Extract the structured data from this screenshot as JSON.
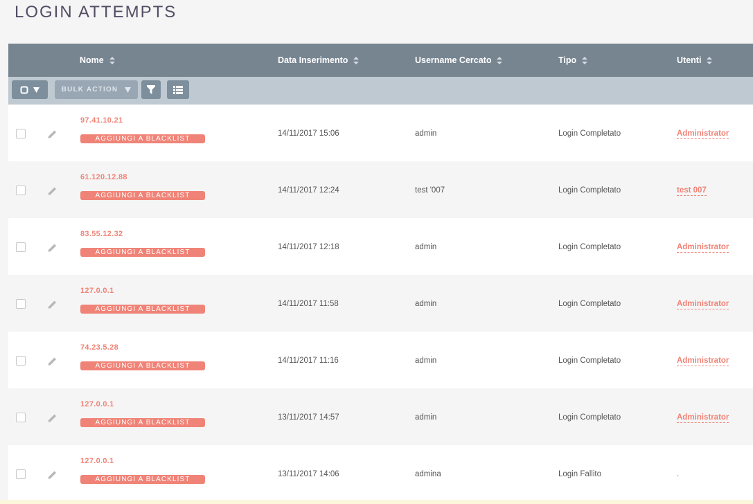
{
  "page": {
    "title": "LOGIN ATTEMPTS"
  },
  "columns": [
    {
      "key": "nome",
      "label": "Nome"
    },
    {
      "key": "data",
      "label": "Data Inserimento"
    },
    {
      "key": "username",
      "label": "Username Cercato"
    },
    {
      "key": "tipo",
      "label": "Tipo"
    },
    {
      "key": "utenti",
      "label": "Utenti"
    }
  ],
  "toolbar": {
    "bulk_action_label": "BULK ACTION"
  },
  "rows": [
    {
      "ip": "97.41.10.21",
      "blacklist_label": "AGGIUNGI A BLACKLIST",
      "date": "14/11/2017 15:06",
      "username": "admin",
      "type": "Login Completato",
      "user": "Administrator"
    },
    {
      "ip": "61.120.12.88",
      "blacklist_label": "AGGIUNGI A BLACKLIST",
      "date": "14/11/2017 12:24",
      "username": "test '007",
      "type": "Login Completato",
      "user": "test 007"
    },
    {
      "ip": "83.55.12.32",
      "blacklist_label": "AGGIUNGI A BLACKLIST",
      "date": "14/11/2017 12:18",
      "username": "admin",
      "type": "Login Completato",
      "user": "Administrator"
    },
    {
      "ip": "127.0.0.1",
      "blacklist_label": "AGGIUNGI A BLACKLIST",
      "date": "14/11/2017 11:58",
      "username": "admin",
      "type": "Login Completato",
      "user": "Administrator"
    },
    {
      "ip": "74.23.5.28",
      "blacklist_label": "AGGIUNGI A BLACKLIST",
      "date": "14/11/2017 11:16",
      "username": "admin",
      "type": "Login Completato",
      "user": "Administrator"
    },
    {
      "ip": "127.0.0.1",
      "blacklist_label": "AGGIUNGI A BLACKLIST",
      "date": "13/11/2017 14:57",
      "username": "admin",
      "type": "Login Completato",
      "user": "Administrator"
    },
    {
      "ip": "127.0.0.1",
      "blacklist_label": "AGGIUNGI A BLACKLIST",
      "date": "13/11/2017 14:06",
      "username": "admina",
      "type": "Login Fallito",
      "user": "."
    }
  ],
  "colors": {
    "header": "#778591",
    "toolbar": "#bfc9d1",
    "accent": "#f08377"
  }
}
